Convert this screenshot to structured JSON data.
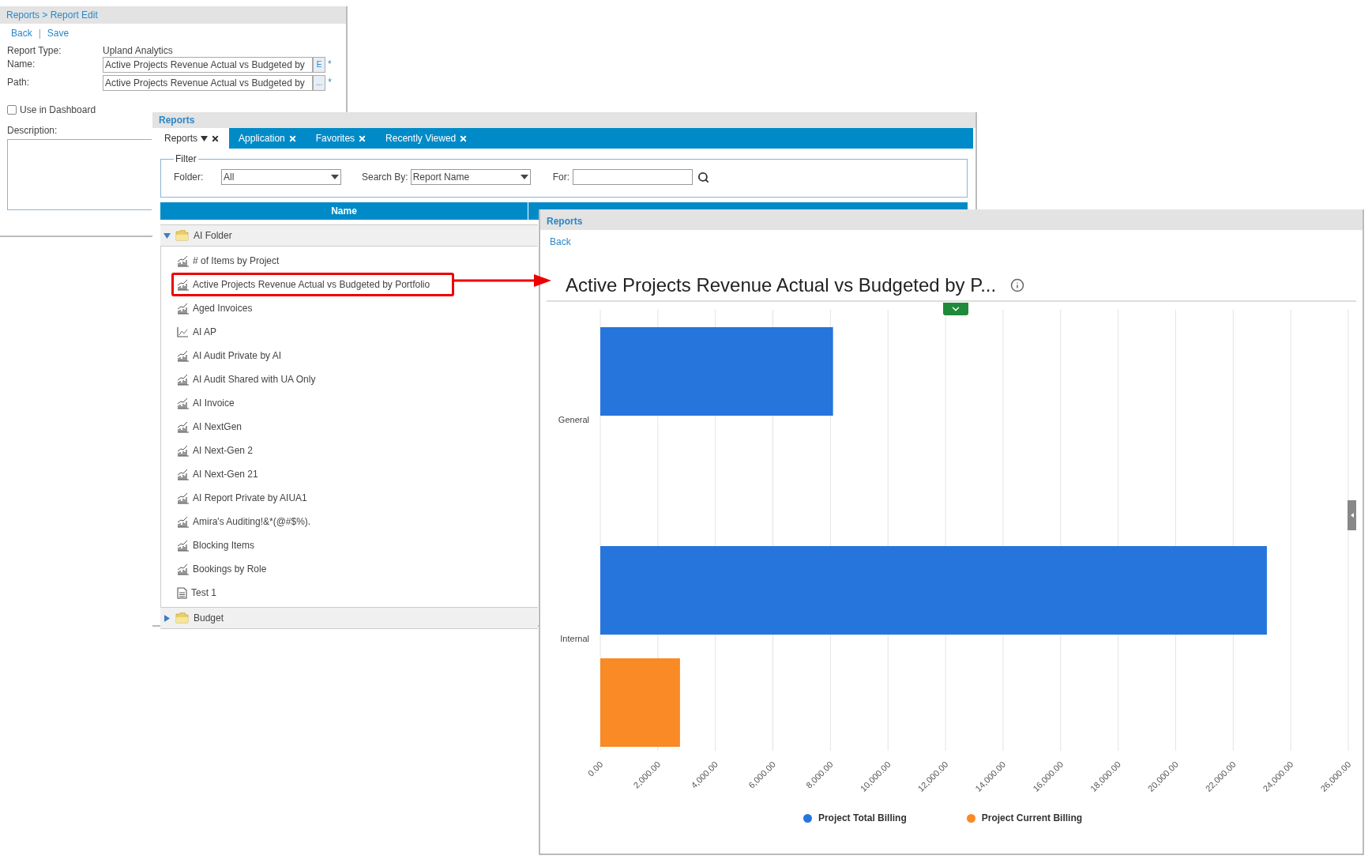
{
  "report_edit": {
    "breadcrumb": "Reports > Report Edit",
    "actions": [
      "Back",
      "Save"
    ],
    "action_separator": "|",
    "fields": [
      {
        "kind": "text",
        "label": "Report Type:",
        "value": "Upland Analytics"
      },
      {
        "kind": "input",
        "label": "Name:",
        "value": "Active Projects Revenue Actual vs Budgeted by",
        "button": "E",
        "required": "*"
      },
      {
        "kind": "input",
        "label": "Path:",
        "value": "Active Projects Revenue Actual vs Budgeted by",
        "button": "...",
        "required": "*"
      }
    ],
    "use_in_dashboard": {
      "label": "Use in Dashboard",
      "checked": false
    },
    "description": {
      "label": "Description:"
    }
  },
  "reports_browser": {
    "title": "Reports",
    "tabs": [
      {
        "label": "Reports",
        "selected": true,
        "dropdown": true
      },
      {
        "label": "Application",
        "selected": false,
        "dropdown": false
      },
      {
        "label": "Favorites",
        "selected": false,
        "dropdown": false
      },
      {
        "label": "Recently Viewed",
        "selected": false,
        "dropdown": false
      }
    ],
    "filter": {
      "legend": "Filter",
      "folder_label": "Folder:",
      "folder_value": "All",
      "search_by_label": "Search By:",
      "search_by_value": "Report Name",
      "for_label": "For:"
    },
    "table": {
      "columns": [
        "Name"
      ]
    },
    "folders": [
      {
        "name": "AI Folder",
        "expanded": true,
        "children": [
          {
            "name": "# of Items by Project",
            "kind": "chart",
            "highlighted": false
          },
          {
            "name": "Active Projects Revenue Actual vs Budgeted by Portfolio",
            "kind": "chart",
            "highlighted": true
          },
          {
            "name": "Aged Invoices",
            "kind": "chart",
            "highlighted": false
          },
          {
            "name": "AI AP",
            "kind": "line",
            "highlighted": false
          },
          {
            "name": "AI Audit Private by AI",
            "kind": "chart",
            "highlighted": false
          },
          {
            "name": "AI Audit Shared with UA Only",
            "kind": "chart",
            "highlighted": false
          },
          {
            "name": "AI Invoice",
            "kind": "chart",
            "highlighted": false
          },
          {
            "name": "AI NextGen",
            "kind": "chart",
            "highlighted": false
          },
          {
            "name": "AI Next-Gen 2",
            "kind": "chart",
            "highlighted": false
          },
          {
            "name": "AI Next-Gen 21",
            "kind": "chart",
            "highlighted": false
          },
          {
            "name": "AI Report Private by AIUA1",
            "kind": "chart",
            "highlighted": false
          },
          {
            "name": "Amira's Auditing!&*(@#$%).",
            "kind": "chart",
            "highlighted": false
          },
          {
            "name": "Blocking Items",
            "kind": "chart",
            "highlighted": false
          },
          {
            "name": "Bookings by Role",
            "kind": "chart",
            "highlighted": false
          },
          {
            "name": "Test 1",
            "kind": "document",
            "highlighted": false
          }
        ]
      },
      {
        "name": "Budget",
        "expanded": false
      }
    ]
  },
  "report_view": {
    "title": "Reports",
    "back": "Back",
    "report_title": "Active Projects Revenue Actual vs Budgeted by P...",
    "chart_data": {
      "type": "bar",
      "orientation": "horizontal",
      "grid": true,
      "categories": [
        "General",
        "Internal"
      ],
      "series": [
        {
          "name": "Project Total Billing",
          "color": "#2675dd",
          "values": [
            8090,
            23170
          ]
        },
        {
          "name": "Project Current Billing",
          "color": "#f98a25",
          "values": [
            null,
            2770
          ]
        }
      ],
      "xlim": [
        0,
        26000
      ],
      "xticks": [
        {
          "value": 0,
          "label": "0.00"
        },
        {
          "value": 2000,
          "label": "2,000.00"
        },
        {
          "value": 4000,
          "label": "4,000.00"
        },
        {
          "value": 6000,
          "label": "6,000.00"
        },
        {
          "value": 8000,
          "label": "8,000.00"
        },
        {
          "value": 10000,
          "label": "10,000.00"
        },
        {
          "value": 12000,
          "label": "12,000.00"
        },
        {
          "value": 14000,
          "label": "14,000.00"
        },
        {
          "value": 16000,
          "label": "16,000.00"
        },
        {
          "value": 18000,
          "label": "18,000.00"
        },
        {
          "value": 20000,
          "label": "20,000.00"
        },
        {
          "value": 22000,
          "label": "22,000.00"
        },
        {
          "value": 24000,
          "label": "24,000.00"
        },
        {
          "value": 26000,
          "label": "26,000.00"
        }
      ]
    }
  }
}
